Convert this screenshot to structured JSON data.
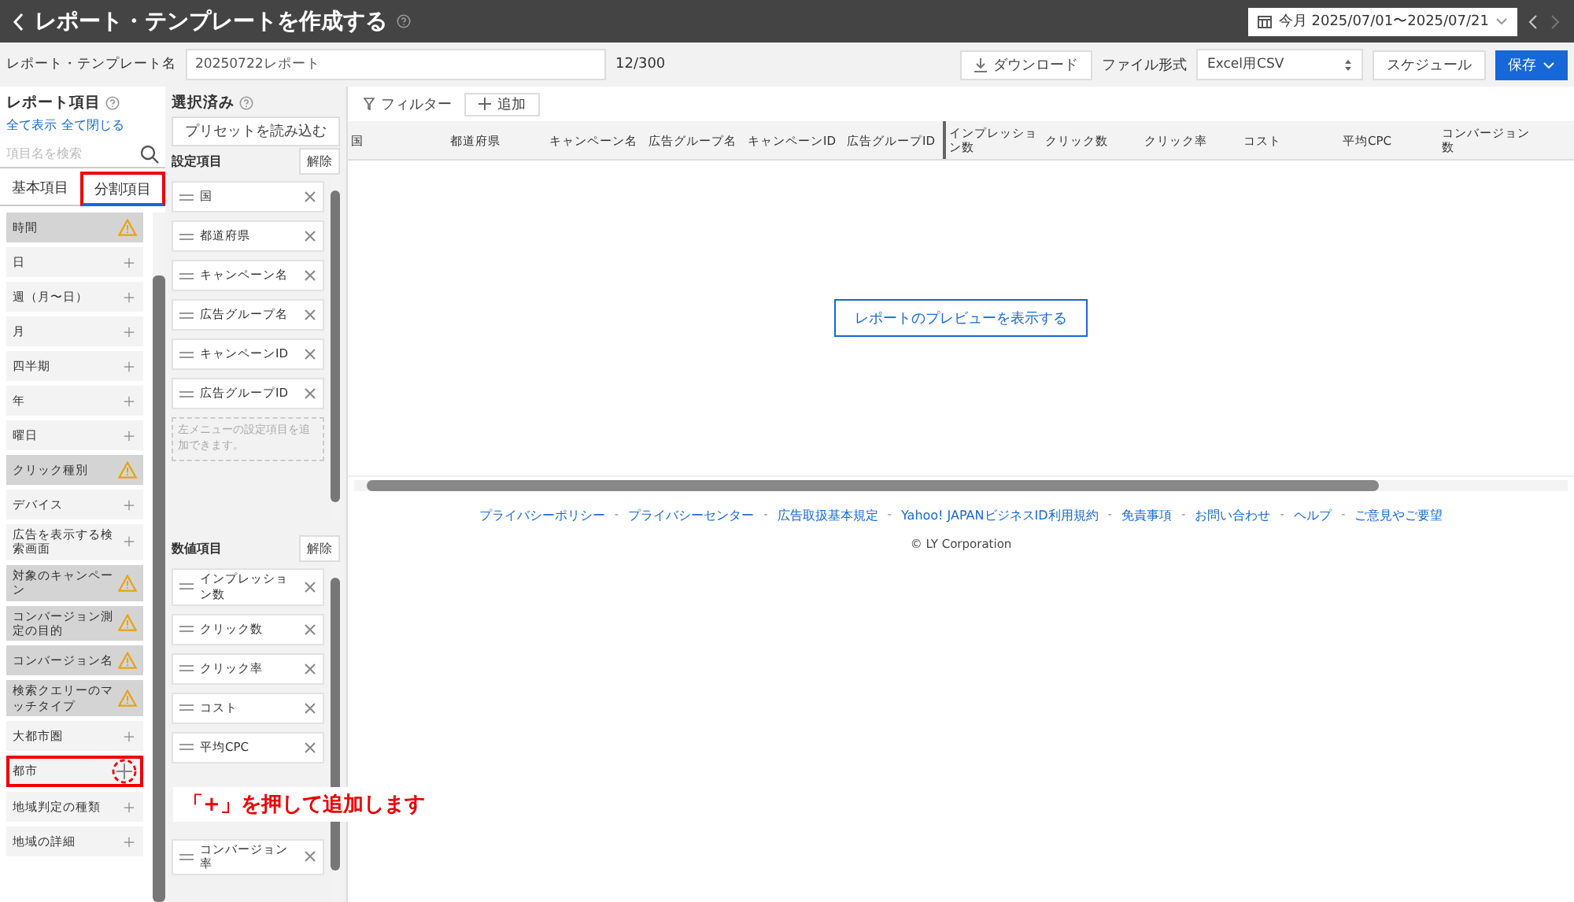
{
  "header": {
    "title": "レポート・テンプレートを作成する",
    "date_range": "今月 2025/07/01〜2025/07/21"
  },
  "toolbar": {
    "name_label": "レポート・テンプレート名",
    "name_value": "20250722レポート",
    "char_count": "12/300",
    "download": "ダウンロード",
    "format_label": "ファイル形式",
    "format_value": "Excel用CSV",
    "schedule": "スケジュール",
    "save": "保存"
  },
  "report_items": {
    "title": "レポート項目",
    "show_all": "全て表示",
    "collapse_all": "全て閉じる",
    "search": {
      "placeholder": "項目名を検索"
    },
    "tabs": [
      {
        "label": "基本項目",
        "selected": false,
        "highlight": false
      },
      {
        "label": "分割項目",
        "selected": true,
        "highlight": true
      }
    ],
    "items": [
      {
        "label": "時間",
        "kind": "warning",
        "highlight": false
      },
      {
        "label": "日",
        "kind": "add",
        "highlight": false
      },
      {
        "label": "週（月〜日）",
        "kind": "add",
        "highlight": false
      },
      {
        "label": "月",
        "kind": "add",
        "highlight": false
      },
      {
        "label": "四半期",
        "kind": "add",
        "highlight": false
      },
      {
        "label": "年",
        "kind": "add",
        "highlight": false
      },
      {
        "label": "曜日",
        "kind": "add",
        "highlight": false
      },
      {
        "label": "クリック種別",
        "kind": "warning",
        "highlight": false
      },
      {
        "label": "デバイス",
        "kind": "add",
        "highlight": false
      },
      {
        "label": "広告を表示する検索画面",
        "kind": "add",
        "highlight": false
      },
      {
        "label": "対象のキャンペーン",
        "kind": "warning",
        "highlight": false
      },
      {
        "label": "コンバージョン測定の目的",
        "kind": "warning",
        "highlight": false
      },
      {
        "label": "コンバージョン名",
        "kind": "warning",
        "highlight": false
      },
      {
        "label": "検索クエリーのマッチタイプ",
        "kind": "warning",
        "highlight": false
      },
      {
        "label": "大都市圏",
        "kind": "add",
        "highlight": false
      },
      {
        "label": "都市",
        "kind": "add",
        "highlight": true
      },
      {
        "label": "地域判定の種類",
        "kind": "add",
        "highlight": false
      },
      {
        "label": "地域の詳細",
        "kind": "add",
        "highlight": false
      }
    ]
  },
  "selected": {
    "title": "選択済み",
    "preset_button": "プリセットを読み込む",
    "setting_section": {
      "title": "設定項目",
      "clear": "解除",
      "chips": [
        "国",
        "都道府県",
        "キャンペーン名",
        "広告グループ名",
        "キャンペーンID",
        "広告グループID"
      ],
      "hint": "左メニューの設定項目を追加できます。"
    },
    "metric_section": {
      "title": "数値項目",
      "clear": "解除",
      "chips": [
        "インプレッション数",
        "クリック数",
        "クリック率",
        "コスト",
        "平均CPC"
      ],
      "more_chips": [
        "コンバージョン率"
      ]
    }
  },
  "callout": "「+」を押して追加します",
  "preview": {
    "filter": "フィルター",
    "add": "追加",
    "columns": [
      "国",
      "都道府県",
      "キャンペーン名",
      "広告グループ名",
      "キャンペーンID",
      "広告グループID",
      "インプレッション数",
      "クリック数",
      "クリック率",
      "コスト",
      "平均CPC",
      "コンバージョン数"
    ],
    "show_preview": "レポートのプレビューを表示する"
  },
  "footer": {
    "links": [
      "プライバシーポリシー",
      "プライバシーセンター",
      "広告取扱基本規定",
      "Yahoo! JAPANビジネスID利用規約",
      "免責事項",
      "お問い合わせ",
      "ヘルプ",
      "ご意見やご要望"
    ],
    "separators": [
      "-",
      "-",
      "-",
      "-",
      "-",
      "-",
      "-"
    ],
    "copyright": "© LY Corporation"
  }
}
